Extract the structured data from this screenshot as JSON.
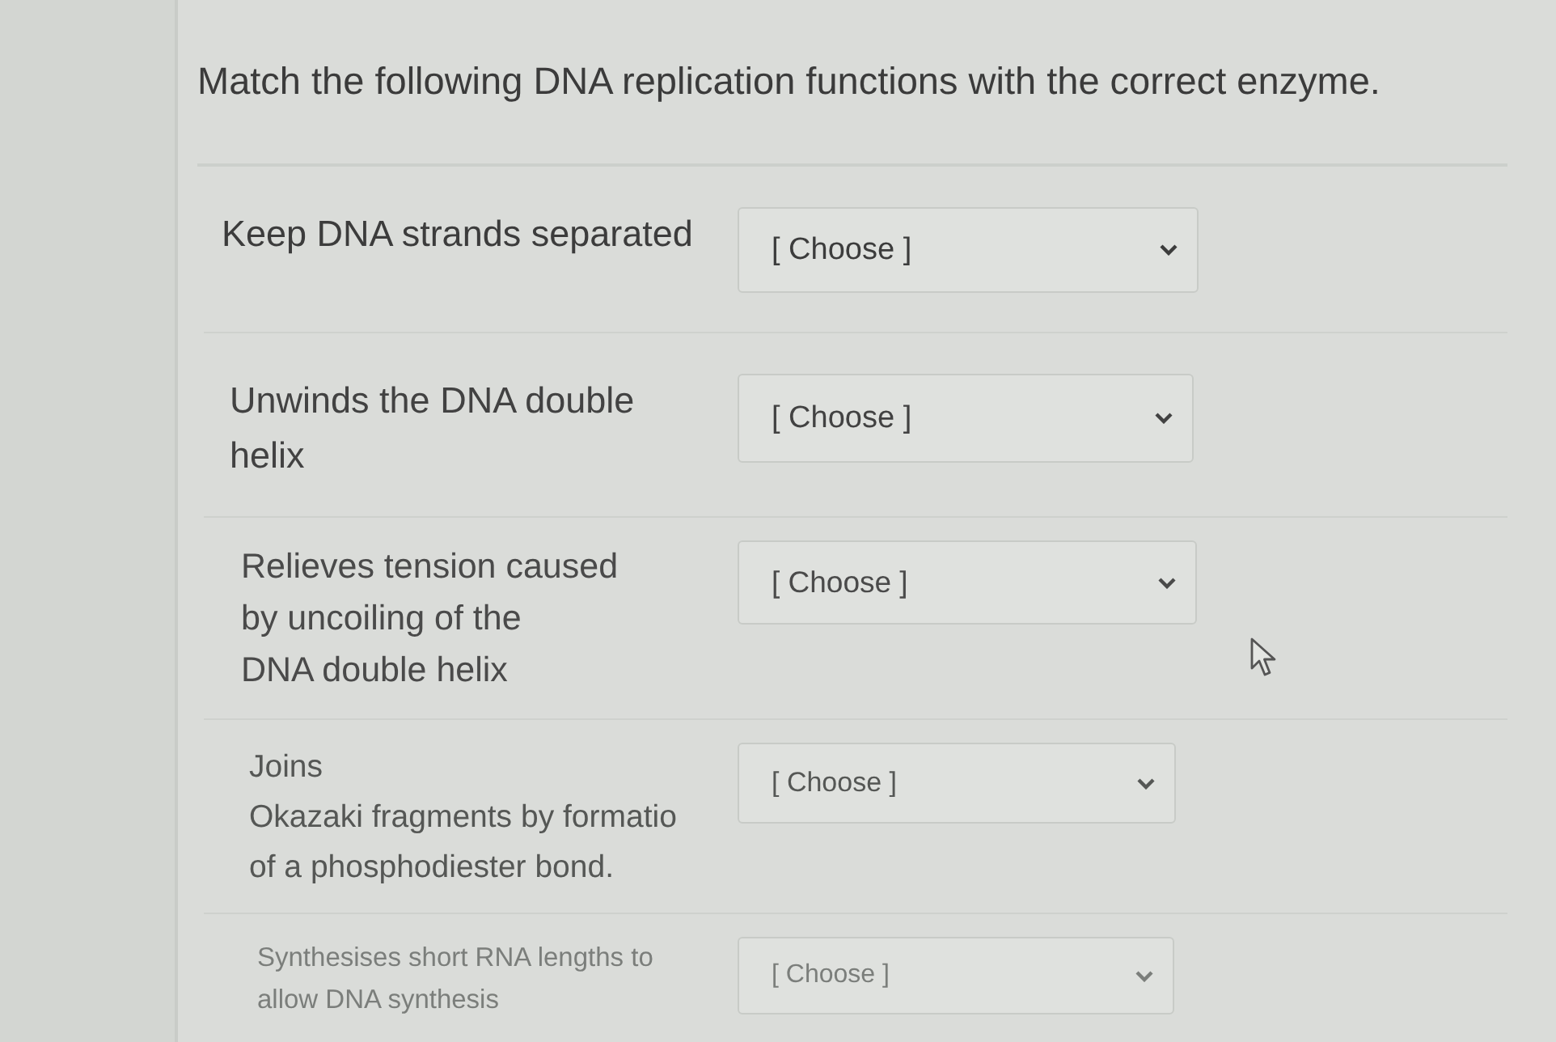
{
  "question": {
    "prompt": "Match the following DNA replication functions with the correct enzyme."
  },
  "rows": [
    {
      "label_lines": [
        "Keep DNA strands separated"
      ],
      "select": {
        "placeholder": "[ Choose ]"
      }
    },
    {
      "label_lines": [
        "Unwinds the DNA double",
        "helix"
      ],
      "select": {
        "placeholder": "[ Choose ]"
      }
    },
    {
      "label_lines": [
        "Relieves tension caused",
        "by uncoiling of the",
        "DNA double helix"
      ],
      "select": {
        "placeholder": "[ Choose ]"
      }
    },
    {
      "label_lines": [
        "Joins",
        "Okazaki fragments by formatio",
        "of a phosphodiester bond."
      ],
      "select": {
        "placeholder": "[ Choose ]"
      }
    },
    {
      "label_lines": [
        "Synthesises short RNA lengths to",
        "allow DNA synthesis"
      ],
      "select": {
        "placeholder": "[ Choose ]"
      }
    }
  ]
}
